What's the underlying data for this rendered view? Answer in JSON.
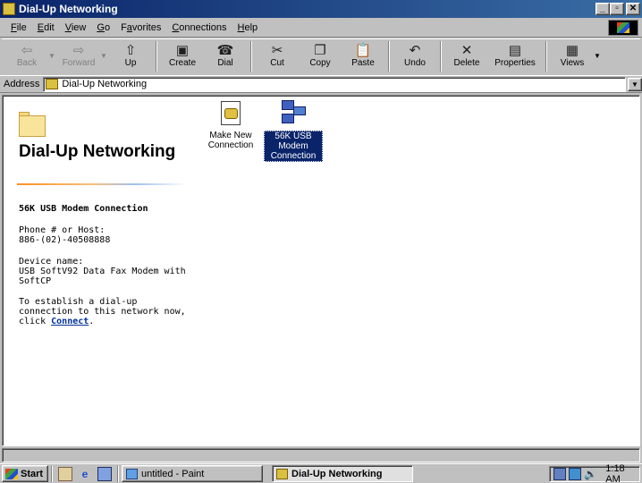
{
  "window": {
    "title": "Dial-Up Networking",
    "controls": {
      "minimize": "_",
      "maximize": "▫",
      "close": "✕"
    }
  },
  "menu": [
    {
      "label": "File",
      "key": "F",
      "rest": "ile"
    },
    {
      "label": "Edit",
      "key": "E",
      "rest": "dit"
    },
    {
      "label": "View",
      "key": "V",
      "rest": "iew"
    },
    {
      "label": "Go",
      "key": "G",
      "rest": "o"
    },
    {
      "label": "Favorites",
      "pre": "F",
      "key": "a",
      "rest": "vorites"
    },
    {
      "label": "Connections",
      "key": "C",
      "rest": "onnections"
    },
    {
      "label": "Help",
      "key": "H",
      "rest": "elp"
    }
  ],
  "toolbar": {
    "back": "Back",
    "forward": "Forward",
    "up": "Up",
    "create": "Create",
    "dial": "Dial",
    "cut": "Cut",
    "copy": "Copy",
    "paste": "Paste",
    "undo": "Undo",
    "delete": "Delete",
    "properties": "Properties",
    "views": "Views"
  },
  "icons": {
    "back": "⇦",
    "forward": "⇨",
    "up": "⇧",
    "create": "▣",
    "dial": "☎",
    "cut": "✂",
    "copy": "❐",
    "paste": "📋",
    "undo": "↶",
    "delete": "✕",
    "properties": "▤",
    "views": "▦",
    "dropdown": "▼",
    "volume": "🔊"
  },
  "address": {
    "label": "Address",
    "value": "Dial-Up Networking"
  },
  "webview": {
    "title": "Dial-Up Networking",
    "connection_name": "56K USB Modem Connection",
    "phone_label": "Phone # or Host:",
    "phone_value": "886-(02)-40508888",
    "device_label": "Device name:",
    "device_value": "USB SoftV92 Data Fax Modem with SoftCP",
    "instructions": "To establish a dial-up connection to this network now, click",
    "connect_link": "Connect",
    "instructions_end": "."
  },
  "items": [
    {
      "label": "Make New Connection"
    },
    {
      "label": "56K USB Modem Connection"
    }
  ],
  "taskbar": {
    "start": "Start",
    "paint_task": "untitled - Paint",
    "dialup_task": "Dial-Up Networking",
    "clock": "1:18 AM"
  }
}
